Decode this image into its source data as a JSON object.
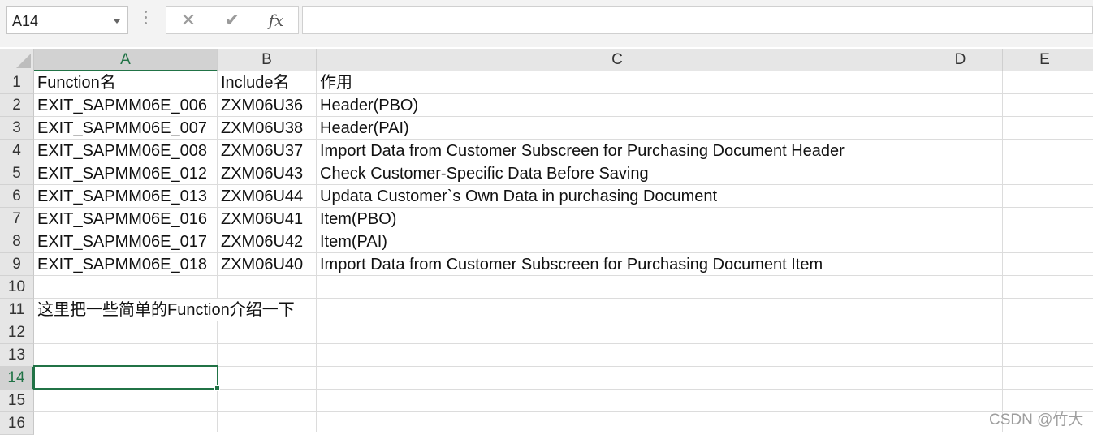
{
  "formula_bar": {
    "name_box": "A14",
    "cancel_symbol": "✕",
    "enter_symbol": "✔",
    "fx_symbol": "fx",
    "formula": ""
  },
  "columns": [
    "A",
    "B",
    "C",
    "D",
    "E"
  ],
  "rows": [
    "1",
    "2",
    "3",
    "4",
    "5",
    "6",
    "7",
    "8",
    "9",
    "10",
    "11",
    "12",
    "13",
    "14",
    "15",
    "16"
  ],
  "cells": {
    "r1": {
      "a": "Function名",
      "b": "Include名",
      "c": "作用"
    },
    "r2": {
      "a": "EXIT_SAPMM06E_006",
      "b": "ZXM06U36",
      "c": "Header(PBO)"
    },
    "r3": {
      "a": "EXIT_SAPMM06E_007",
      "b": "ZXM06U38",
      "c": "Header(PAI)"
    },
    "r4": {
      "a": "EXIT_SAPMM06E_008",
      "b": "ZXM06U37",
      "c": "Import Data from Customer Subscreen for Purchasing Document Header"
    },
    "r5": {
      "a": "EXIT_SAPMM06E_012",
      "b": "ZXM06U43",
      "c": "Check Customer-Specific Data Before Saving"
    },
    "r6": {
      "a": "EXIT_SAPMM06E_013",
      "b": "ZXM06U44",
      "c": "Updata Customer`s Own Data in purchasing Document"
    },
    "r7": {
      "a": "EXIT_SAPMM06E_016",
      "b": "ZXM06U41",
      "c": "Item(PBO)"
    },
    "r8": {
      "a": "EXIT_SAPMM06E_017",
      "b": "ZXM06U42",
      "c": "Item(PAI)"
    },
    "r9": {
      "a": "EXIT_SAPMM06E_018",
      "b": "ZXM06U40",
      "c": "Import Data from Customer Subscreen for Purchasing Document Item"
    },
    "r11": {
      "a": "这里把一些简单的Function介绍一下"
    }
  },
  "selected_cell": "A14",
  "watermark": "CSDN @竹大",
  "colors": {
    "accent": "#217346",
    "header_bg": "#e6e6e6",
    "gridline": "#dcdcdc"
  }
}
